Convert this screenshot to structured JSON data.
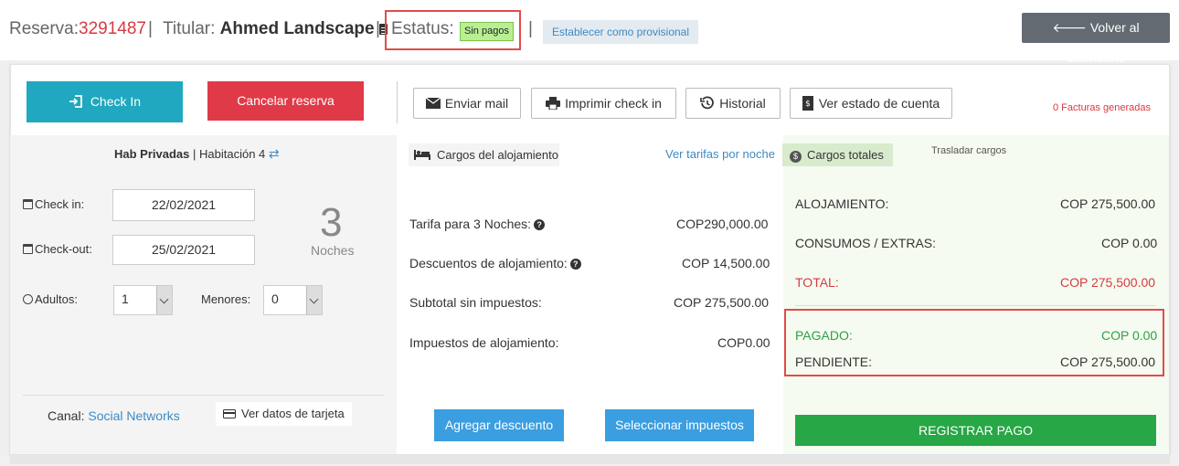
{
  "header": {
    "reserva_label": "Reserva:",
    "reserva_number": "3291487",
    "sep1": "|",
    "titular_label": "Titular:",
    "titular_name": "Ahmed Landscape",
    "sep2": "|",
    "estatus_label": "Estatus:",
    "estatus_badge": "Sin pagos",
    "sep3": "|",
    "provisional_button": "Establecer como provisional",
    "volver_button": "Volver al calendario"
  },
  "toolbar": {
    "checkin_button": "Check In",
    "cancelar_button": "Cancelar reserva",
    "enviar_mail": "Enviar mail",
    "imprimir_checkin": "Imprimir check in",
    "historial": "Historial",
    "estado_cuenta": "Ver estado de cuenta",
    "facturas": "0 Facturas generadas"
  },
  "room": {
    "type": "Hab Privadas",
    "separator": "|",
    "name": "Habitación 4",
    "checkin_label": "Check in:",
    "checkin_value": "22/02/2021",
    "checkout_label": "Check-out:",
    "checkout_value": "25/02/2021",
    "nights_count": "3",
    "nights_label": "Noches",
    "adultos_label": "Adultos:",
    "adultos_value": "1",
    "menores_label": "Menores:",
    "menores_value": "0",
    "canal_label": "Canal:",
    "canal_value": "Social Networks",
    "tarjeta_button": "Ver datos de tarjeta"
  },
  "charges": {
    "tab_label": "Cargos del alojamiento",
    "tarifas_link": "Ver tarifas por noche",
    "rows": [
      {
        "label": "Tarifa para 3 Noches:",
        "value": "COP290,000.00"
      },
      {
        "label": "Descuentos de alojamiento:",
        "value": "COP 14,500.00"
      },
      {
        "label": "Subtotal sin impuestos:",
        "value": "COP 275,500.00"
      },
      {
        "label": "Impuestos de alojamiento:",
        "value": "COP0.00"
      }
    ],
    "agregar_descuento": "Agregar descuento",
    "seleccionar_impuestos": "Seleccionar impuestos"
  },
  "totals": {
    "tab_label": "Cargos totales",
    "trasladar": "Trasladar cargos",
    "alojamiento_label": "ALOJAMIENTO:",
    "alojamiento_value": "COP 275,500.00",
    "consumos_label": "CONSUMOS / EXTRAS:",
    "consumos_value": "COP 0.00",
    "total_label": "TOTAL:",
    "total_value": "COP 275,500.00",
    "pagado_label": "PAGADO:",
    "pagado_value": "COP 0.00",
    "pendiente_label": "PENDIENTE:",
    "pendiente_value": "COP 275,500.00",
    "registrar_pago": "REGISTRAR PAGO"
  },
  "colors": {
    "accent_red": "#d83a3f",
    "checkin_teal": "#1fa8bf",
    "action_blue": "#3a9ee0",
    "pay_green": "#27a745",
    "badge_green": "#b9ef91"
  }
}
